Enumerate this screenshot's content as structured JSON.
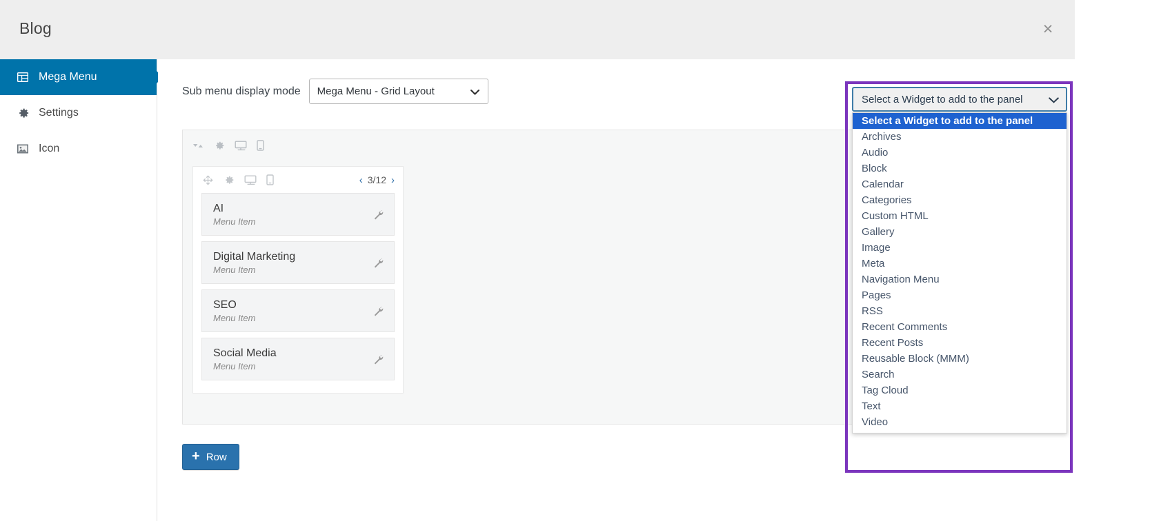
{
  "header": {
    "title": "Blog",
    "close_label": "×",
    "close_icon": "close-icon"
  },
  "sidebar": {
    "items": [
      {
        "label": "Mega Menu",
        "icon": "grid-layout-icon",
        "active": true
      },
      {
        "label": "Settings",
        "icon": "gear-icon",
        "active": false
      },
      {
        "label": "Icon",
        "icon": "image-icon",
        "active": false
      }
    ]
  },
  "main": {
    "display_mode": {
      "label": "Sub menu display mode",
      "value": "Mega Menu - Grid Layout"
    },
    "panel_toolbar_icons": [
      "sort-icon",
      "gear-icon",
      "desktop-icon",
      "mobile-icon"
    ],
    "row": {
      "toolbar_icons": [
        "move-icon",
        "gear-icon",
        "desktop-icon",
        "mobile-icon"
      ],
      "pager": {
        "prev": "‹",
        "next": "›",
        "value": "3/12"
      },
      "items": [
        {
          "title": "AI",
          "subtitle": "Menu Item",
          "action_icon": "wrench-icon"
        },
        {
          "title": "Digital Marketing",
          "subtitle": "Menu Item",
          "action_icon": "wrench-icon"
        },
        {
          "title": "SEO",
          "subtitle": "Menu Item",
          "action_icon": "wrench-icon"
        },
        {
          "title": "Social Media",
          "subtitle": "Menu Item",
          "action_icon": "wrench-icon"
        }
      ]
    },
    "add_row_button": {
      "label": "Row",
      "plus": "+"
    }
  },
  "widget_panel": {
    "select_value": "Select a Widget to add to the panel",
    "highlight_color": "#7b35bd",
    "selected_color": "#1e62d0",
    "options": [
      "Select a Widget to add to the panel",
      "Archives",
      "Audio",
      "Block",
      "Calendar",
      "Categories",
      "Custom HTML",
      "Gallery",
      "Image",
      "Meta",
      "Navigation Menu",
      "Pages",
      "RSS",
      "Recent Comments",
      "Recent Posts",
      "Reusable Block (MMM)",
      "Search",
      "Tag Cloud",
      "Text",
      "Video"
    ],
    "selected_index": 0
  },
  "colors": {
    "header_bg": "#eeeeee",
    "sidebar_active": "#0073aa",
    "button_blue": "#2a72ad"
  }
}
